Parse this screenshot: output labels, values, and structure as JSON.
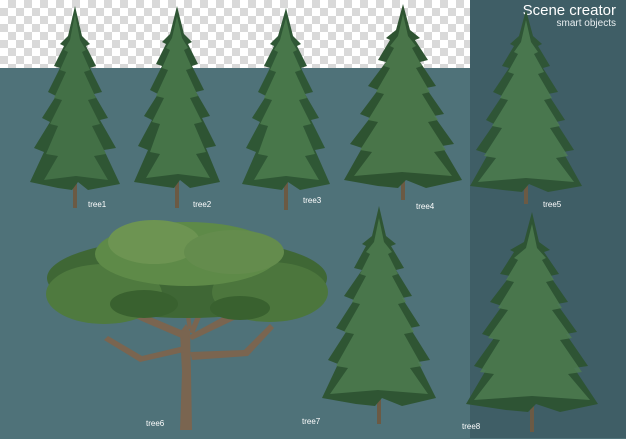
{
  "header": {
    "title": "Scene creator",
    "subtitle": "smart objects"
  },
  "trees": [
    {
      "id": "tree1",
      "label": "tree1",
      "type": "spruce"
    },
    {
      "id": "tree2",
      "label": "tree2",
      "type": "spruce"
    },
    {
      "id": "tree3",
      "label": "tree3",
      "type": "spruce"
    },
    {
      "id": "tree4",
      "label": "tree4",
      "type": "spruce"
    },
    {
      "id": "tree5",
      "label": "tree5",
      "type": "spruce"
    },
    {
      "id": "tree6",
      "label": "tree6",
      "type": "umbrella-pine"
    },
    {
      "id": "tree7",
      "label": "tree7",
      "type": "spruce"
    },
    {
      "id": "tree8",
      "label": "tree8",
      "type": "spruce"
    }
  ],
  "colors": {
    "background": "#4f7279",
    "panel": "#3f5e66",
    "foliage_dark": "#2b4a2e",
    "foliage_mid": "#3f6a3e",
    "foliage_light": "#6e8f4a",
    "trunk": "#6b5a44",
    "label": "#ffffff"
  }
}
